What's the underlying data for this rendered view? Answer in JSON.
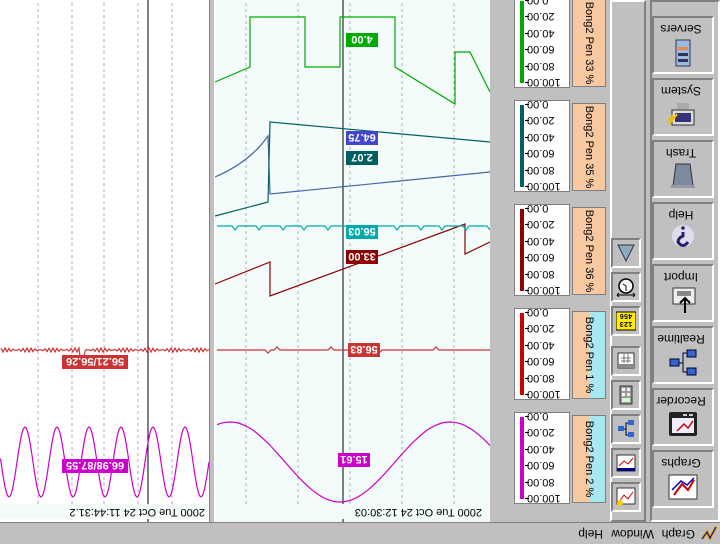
{
  "app": {
    "icon_name": "trend-app-icon"
  },
  "menu": {
    "graph": "Graph",
    "window": "Window",
    "help": "Help"
  },
  "launcher": {
    "items": [
      {
        "label": "Graphs",
        "icon": "graph-chart-icon"
      },
      {
        "label": "Recorder",
        "icon": "recorder-icon"
      },
      {
        "label": "Realtime",
        "icon": "network-nodes-icon"
      },
      {
        "label": "Import",
        "icon": "import-icon"
      },
      {
        "label": "Help",
        "icon": "help-icon"
      },
      {
        "label": "Trash",
        "icon": "trash-icon"
      },
      {
        "label": "System",
        "icon": "system-icon"
      },
      {
        "label": "Servers",
        "icon": "server-icon"
      }
    ]
  },
  "toolstrip": {
    "items": [
      {
        "icon": "new-graph-icon"
      },
      {
        "icon": "graph-window-icon"
      },
      {
        "icon": "network-icon"
      },
      {
        "icon": "calculator-icon"
      },
      {
        "icon": "calendar-icon"
      },
      {
        "icon": "digital-display-icon",
        "text": "123\n456"
      },
      {
        "icon": "timespan-icon"
      },
      {
        "icon": "cone-icon"
      }
    ]
  },
  "pens": [
    {
      "name": "Bong2 Pen 2 %",
      "color": "#cc00cc",
      "label_bg": "#a8e8f0",
      "label_bg2": "#f8c8a0",
      "ticks": [
        "100.00",
        "80.00",
        "60.00",
        "40.00",
        "20.00",
        "0.00"
      ]
    },
    {
      "name": "Bong2 Pen 1 %",
      "color": "#cc0000",
      "label_bg": "#a8e8f0",
      "label_bg2": "#f8c8a0",
      "ticks": [
        "100.00",
        "80.00",
        "60.00",
        "40.00",
        "20.00",
        "0.00"
      ]
    },
    {
      "name": "Bong2 Pen 36 %",
      "color": "#8b0000",
      "label_bg": "#f8c8a0",
      "ticks": [
        "100.00",
        "80.00",
        "60.00",
        "40.00",
        "20.00",
        "0.00"
      ]
    },
    {
      "name": "Bong2 Pen 35 %",
      "color": "#006060",
      "label_bg": "#f8c8a0",
      "ticks": [
        "100.00",
        "80.00",
        "60.00",
        "40.00",
        "20.00",
        "0.00"
      ]
    },
    {
      "name": "Bong2 Pen 33 %",
      "color": "#00aa00",
      "label_bg": "#f8c8a0",
      "ticks": [
        "100.00",
        "80.00",
        "60.00",
        "40.00",
        "20.00",
        "0.00"
      ]
    }
  ],
  "left_chart": {
    "time_label": "2000 Tue Oct 24 11:44:31.2",
    "value_labels": [
      {
        "text": "66.98/87.55",
        "color": "#cc00cc"
      },
      {
        "text": "56.21/56.26",
        "color": "#cc3333"
      }
    ]
  },
  "right_chart": {
    "time_label": "2000 Tue Oct 24 12:30:03",
    "value_labels": [
      {
        "text": "15.61",
        "color": "#cc00cc"
      },
      {
        "text": "56.83",
        "color": "#cc3333"
      },
      {
        "text": "33.00",
        "color": "#8b0000"
      },
      {
        "text": "56.03",
        "color": "#00aaaa"
      },
      {
        "text": "2.07",
        "color": "#006060"
      },
      {
        "text": "64.75",
        "color": "#4444cc"
      },
      {
        "text": "4.00",
        "color": "#00aa00"
      }
    ]
  }
}
